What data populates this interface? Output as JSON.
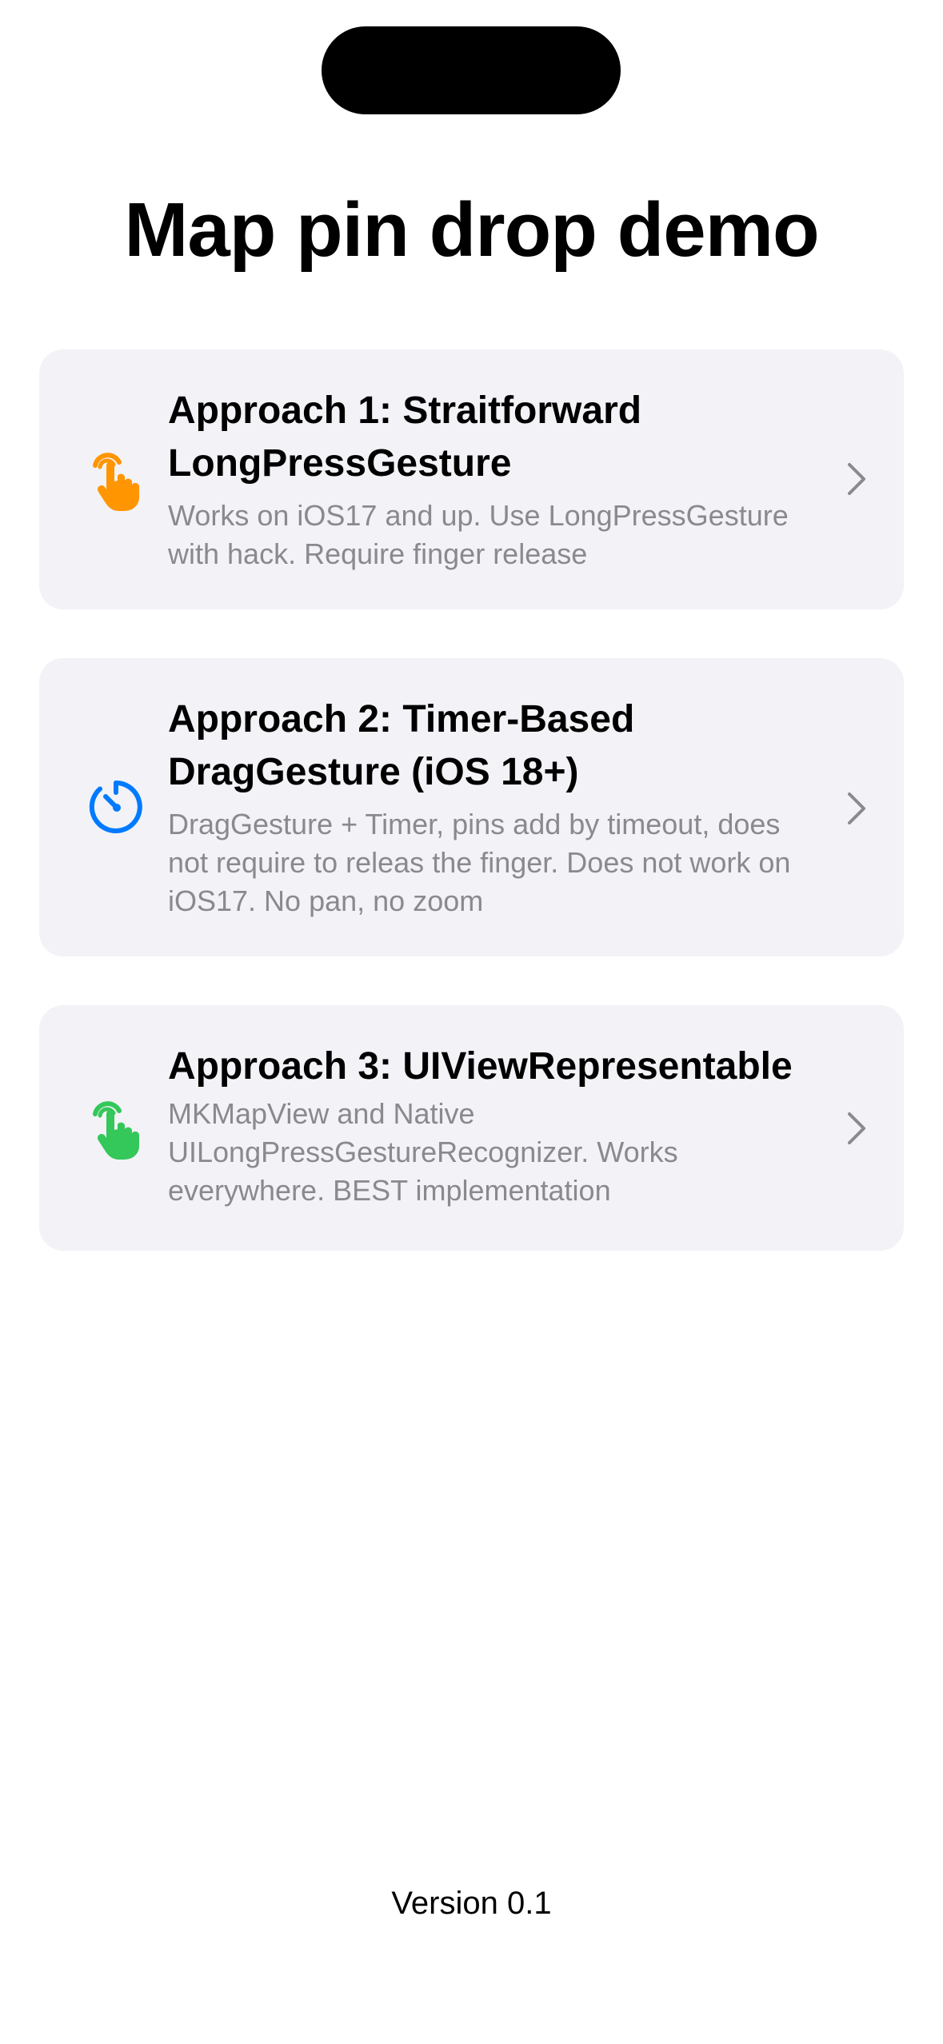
{
  "title": "Map pin drop demo",
  "approaches": [
    {
      "title": "Approach 1: Straitforward LongPressGesture",
      "subtitle": "Works on iOS17 and up. Use LongPressGesture with hack. Require finger release",
      "icon": "hand-tap-icon",
      "icon_color": "#ff9500"
    },
    {
      "title": "Approach 2: Timer-Based DragGesture (iOS 18+)",
      "subtitle": "DragGesture + Timer, pins add by timeout, does not require to releas the finger. Does not work on iOS17. No pan, no zoom",
      "icon": "timer-icon",
      "icon_color": "#007aff"
    },
    {
      "title": "Approach 3: UIViewRepresentable",
      "subtitle": "MKMapView and Native UILongPressGestureRecognizer. Works everywhere. BEST implementation",
      "icon": "hand-tap-icon",
      "icon_color": "#34c759"
    }
  ],
  "footer": {
    "version": "Version 0.1"
  }
}
